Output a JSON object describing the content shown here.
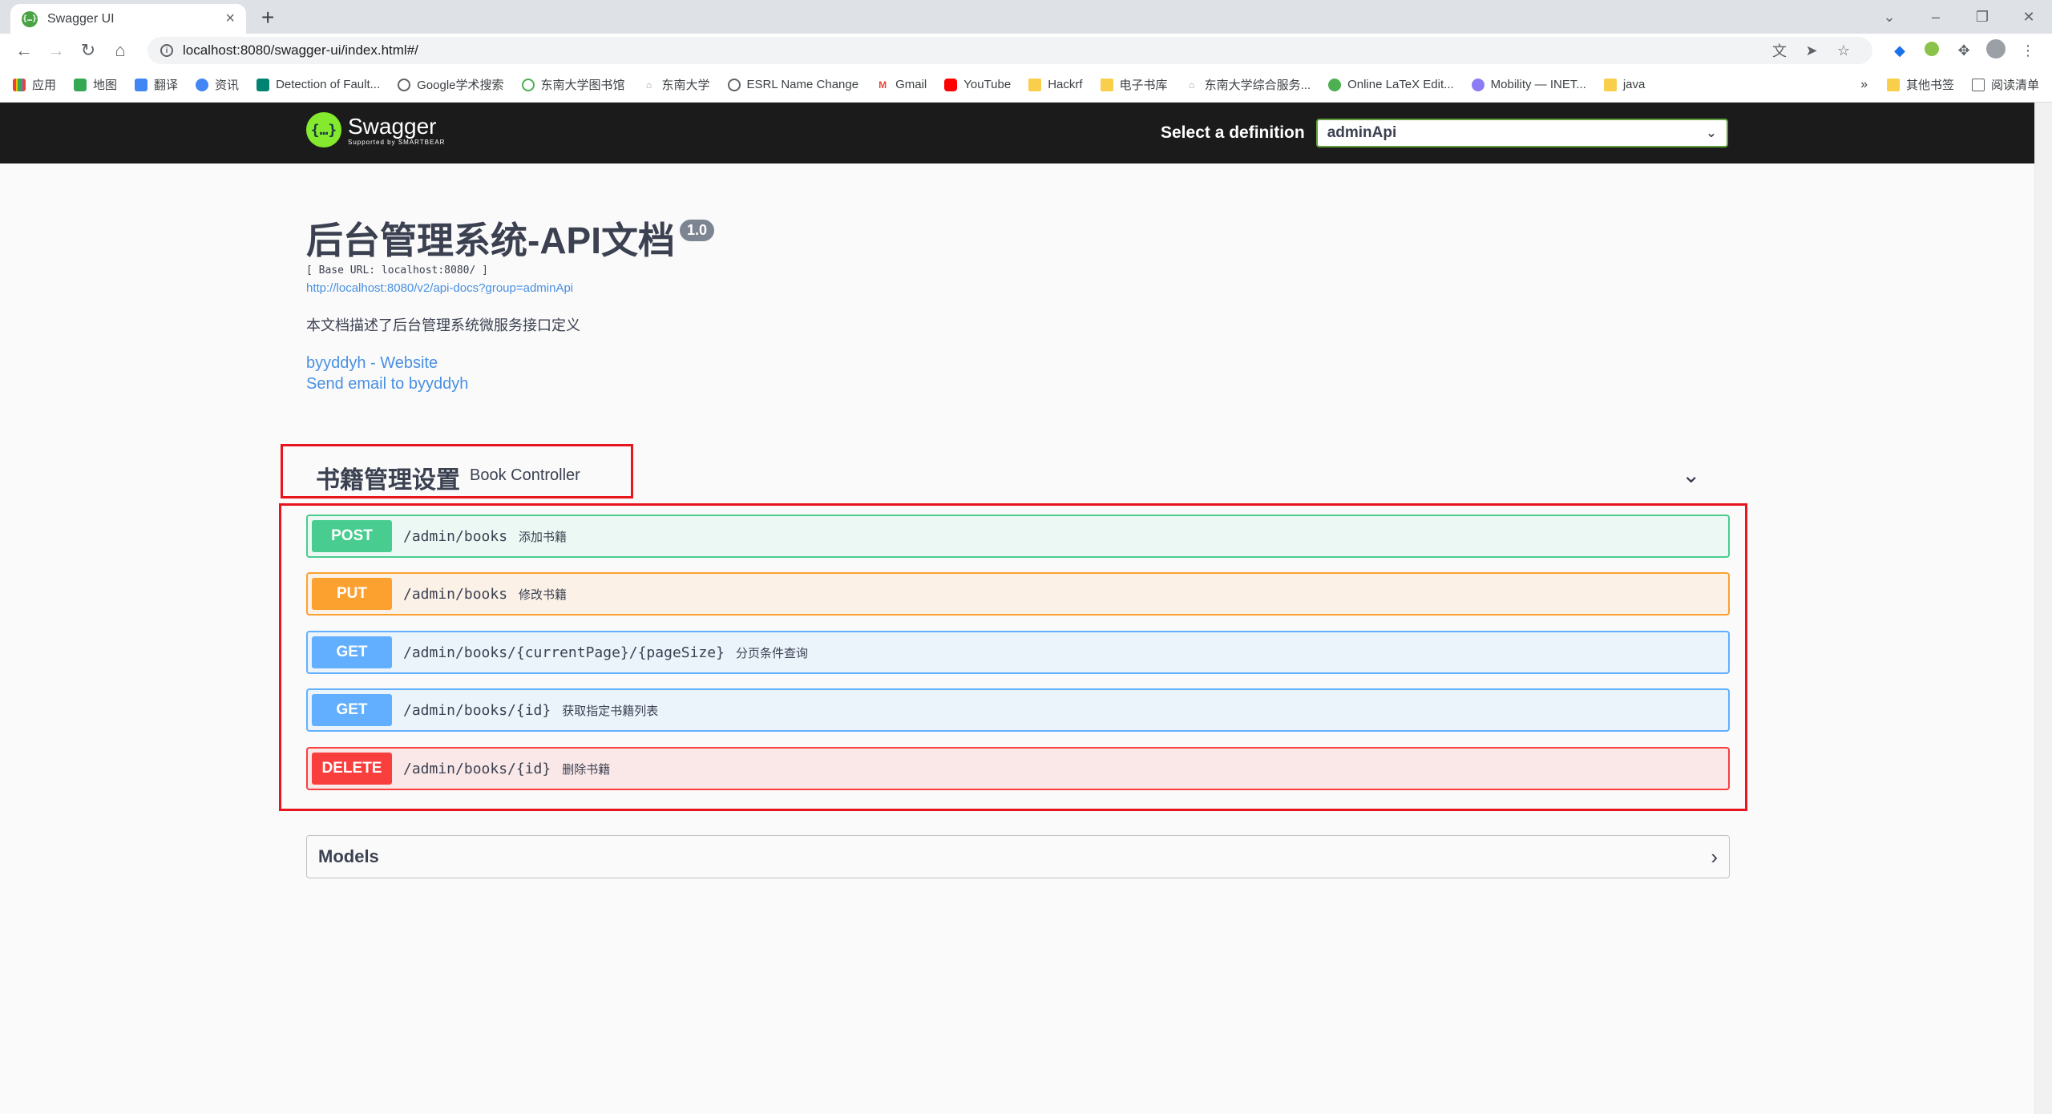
{
  "browser": {
    "tab_title": "Swagger UI",
    "url": "localhost:8080/swagger-ui/index.html#/",
    "bookmarks": [
      {
        "label": "应用",
        "icon": "apps-icon"
      },
      {
        "label": "地图",
        "icon": "maps-icon"
      },
      {
        "label": "翻译",
        "icon": "translate-icon"
      },
      {
        "label": "资讯",
        "icon": "news-icon"
      },
      {
        "label": "Detection of Fault...",
        "icon": "bing-icon"
      },
      {
        "label": "Google学术搜索",
        "icon": "scholar-icon"
      },
      {
        "label": "东南大学图书馆",
        "icon": "library-icon"
      },
      {
        "label": "东南大学",
        "icon": "home-icon"
      },
      {
        "label": "ESRL Name Change",
        "icon": "globe-icon"
      },
      {
        "label": "Gmail",
        "icon": "gmail-icon"
      },
      {
        "label": "YouTube",
        "icon": "youtube-icon"
      },
      {
        "label": "Hackrf",
        "icon": "folder-icon"
      },
      {
        "label": "电子书库",
        "icon": "folder-icon"
      },
      {
        "label": "东南大学综合服务...",
        "icon": "home-icon"
      },
      {
        "label": "Online LaTeX Edit...",
        "icon": "overleaf-icon"
      },
      {
        "label": "Mobility — INET...",
        "icon": "mobility-icon"
      },
      {
        "label": "java",
        "icon": "folder-icon"
      }
    ],
    "more_bookmarks": "»",
    "other_bookmarks": "其他书签",
    "reading_list": "阅读清单"
  },
  "swagger": {
    "logo_name": "Swagger",
    "logo_sub": "Supported by SMARTBEAR",
    "select_label": "Select a definition",
    "selected_definition": "adminApi",
    "title": "后台管理系统-API文档",
    "version": "1.0",
    "base_url": "[ Base URL: localhost:8080/ ]",
    "api_docs_link": "http://localhost:8080/v2/api-docs?group=adminApi",
    "description": "本文档描述了后台管理系统微服务接口定义",
    "website_link": "byyddyh - Website",
    "email_link": "Send email to byyddyh",
    "tag": {
      "name": "书籍管理设置",
      "description": "Book Controller"
    },
    "operations": [
      {
        "method": "POST",
        "path": "/admin/books",
        "summary": "添加书籍"
      },
      {
        "method": "PUT",
        "path": "/admin/books",
        "summary": "修改书籍"
      },
      {
        "method": "GET",
        "path": "/admin/books/{currentPage}/{pageSize}",
        "summary": "分页条件查询"
      },
      {
        "method": "GET",
        "path": "/admin/books/{id}",
        "summary": "获取指定书籍列表"
      },
      {
        "method": "DELETE",
        "path": "/admin/books/{id}",
        "summary": "删除书籍"
      }
    ],
    "models_title": "Models"
  },
  "colors": {
    "post": "#49cc90",
    "put": "#fca130",
    "get": "#61affe",
    "delete": "#f93e3e",
    "highlight": "#e8141e",
    "link": "#4990e2"
  }
}
